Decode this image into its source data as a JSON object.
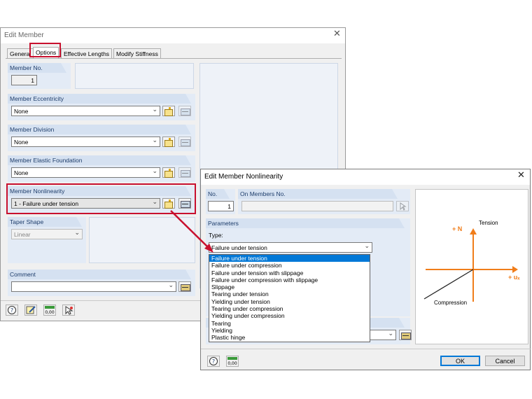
{
  "edit_member": {
    "title": "Edit Member",
    "tabs": [
      "General",
      "Options",
      "Effective Lengths",
      "Modify Stiffness"
    ],
    "member_no": {
      "label": "Member No.",
      "value": "1"
    },
    "eccentricity": {
      "label": "Member Eccentricity",
      "value": "None"
    },
    "division": {
      "label": "Member Division",
      "value": "None"
    },
    "elastic_foundation": {
      "label": "Member Elastic Foundation",
      "value": "None"
    },
    "nonlinearity": {
      "label": "Member Nonlinearity",
      "value": "1 - Failure under tension"
    },
    "taper_shape": {
      "label": "Taper Shape",
      "value": "Linear"
    },
    "comment": {
      "label": "Comment",
      "value": ""
    }
  },
  "nonlinearity_dialog": {
    "title": "Edit Member Nonlinearity",
    "no": {
      "label": "No.",
      "value": "1"
    },
    "on_members": {
      "label": "On Members No.",
      "value": ""
    },
    "parameters_label": "Parameters",
    "type_label": "Type:",
    "type_value": "Failure under tension",
    "options": [
      "Failure under tension",
      "Failure under compression",
      "Failure under tension with slippage",
      "Failure under compression with slippage",
      "Slippage",
      "Tearing under tension",
      "Yielding under tension",
      "Tearing under compression",
      "Yielding under compression",
      "Tearing",
      "Yielding",
      "Plastic hinge"
    ],
    "diagram": {
      "n_label": "+ N",
      "u_label": "+ uₓ",
      "tension": "Tension",
      "compression": "Compression"
    },
    "ok_label": "OK",
    "cancel_label": "Cancel",
    "units_icon_text": "0,00"
  },
  "colors": {
    "accent_red": "#c8102e",
    "diagram_orange": "#f07d1a",
    "selection_blue": "#0078d7"
  }
}
